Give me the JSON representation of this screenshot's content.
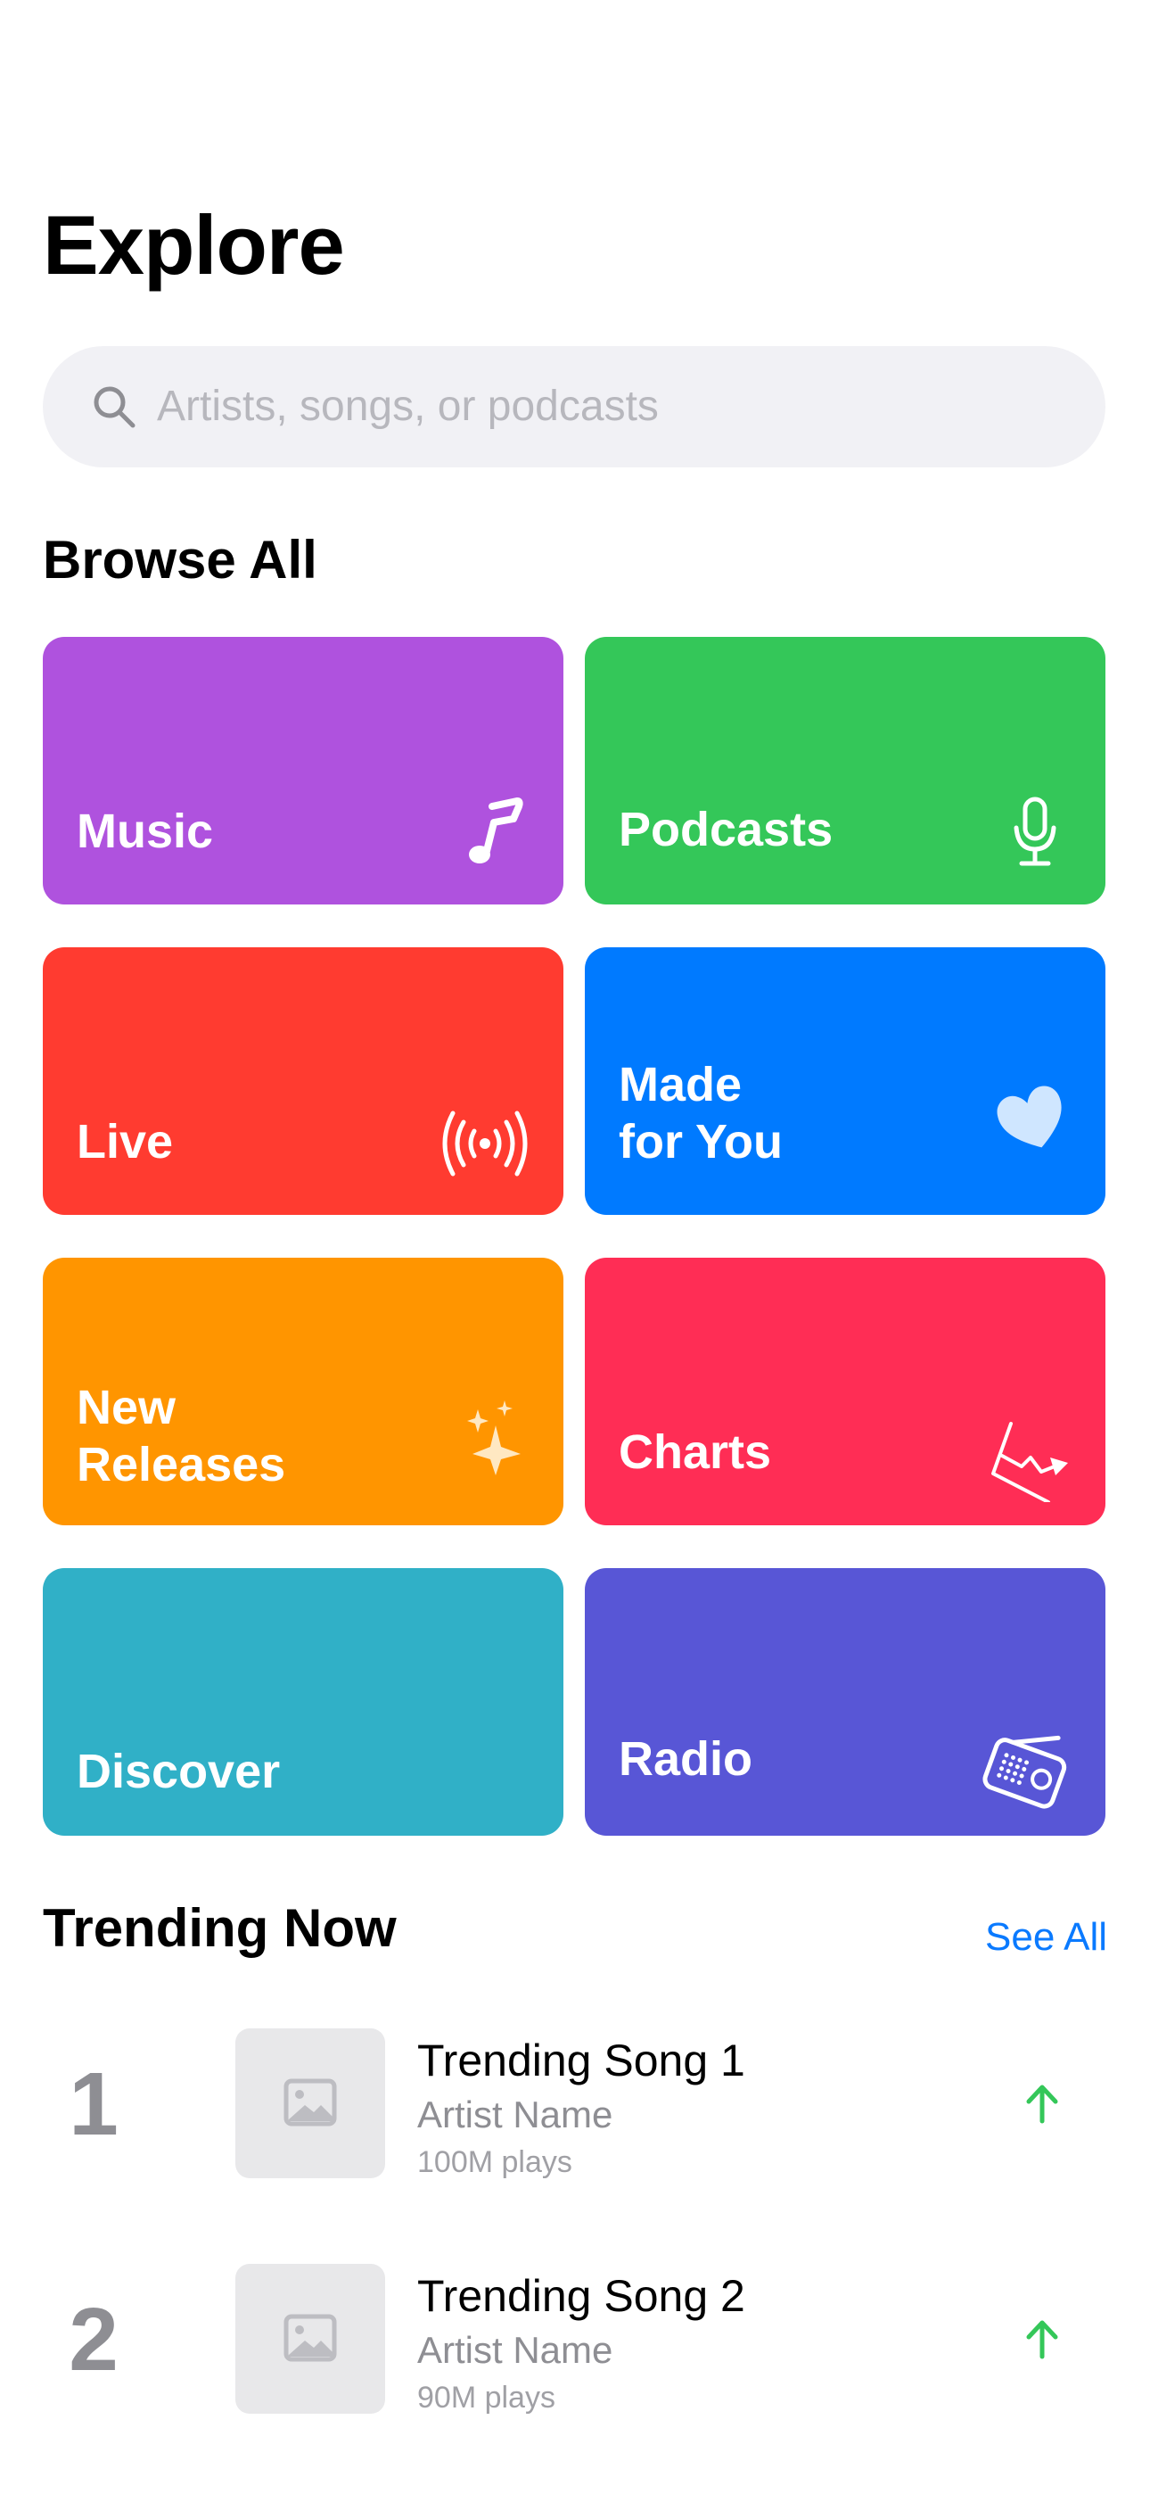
{
  "header": {
    "title": "Explore"
  },
  "search": {
    "placeholder": "Artists, songs, or podcasts"
  },
  "browse": {
    "title": "Browse All",
    "tiles": [
      {
        "label": "Music",
        "color": "#af52de",
        "icon": "music-note-icon"
      },
      {
        "label": "Podcasts",
        "color": "#34c759",
        "icon": "microphone-icon"
      },
      {
        "label": "Live",
        "color": "#ff3b30",
        "icon": "broadcast-icon"
      },
      {
        "label": "Made\nfor You",
        "color": "#007aff",
        "icon": "heart-icon"
      },
      {
        "label": "New\nReleases",
        "color": "#ff9500",
        "icon": "sparkles-icon"
      },
      {
        "label": "Charts",
        "color": "#ff2d55",
        "icon": "chart-icon"
      },
      {
        "label": "Discover",
        "color": "#30b0c7",
        "icon": ""
      },
      {
        "label": "Radio",
        "color": "#5856d6",
        "icon": "radio-icon"
      }
    ]
  },
  "trending": {
    "title": "Trending Now",
    "see_all": "See All",
    "items": [
      {
        "rank": "1",
        "title": "Trending Song 1",
        "artist": "Artist Name",
        "plays": "100M plays",
        "trend": "up"
      },
      {
        "rank": "2",
        "title": "Trending Song 2",
        "artist": "Artist Name",
        "plays": "90M plays",
        "trend": "up"
      }
    ]
  },
  "colors": {
    "accent": "#0a7aff",
    "trend_up": "#34c759",
    "search_bg": "#f1f1f5"
  }
}
